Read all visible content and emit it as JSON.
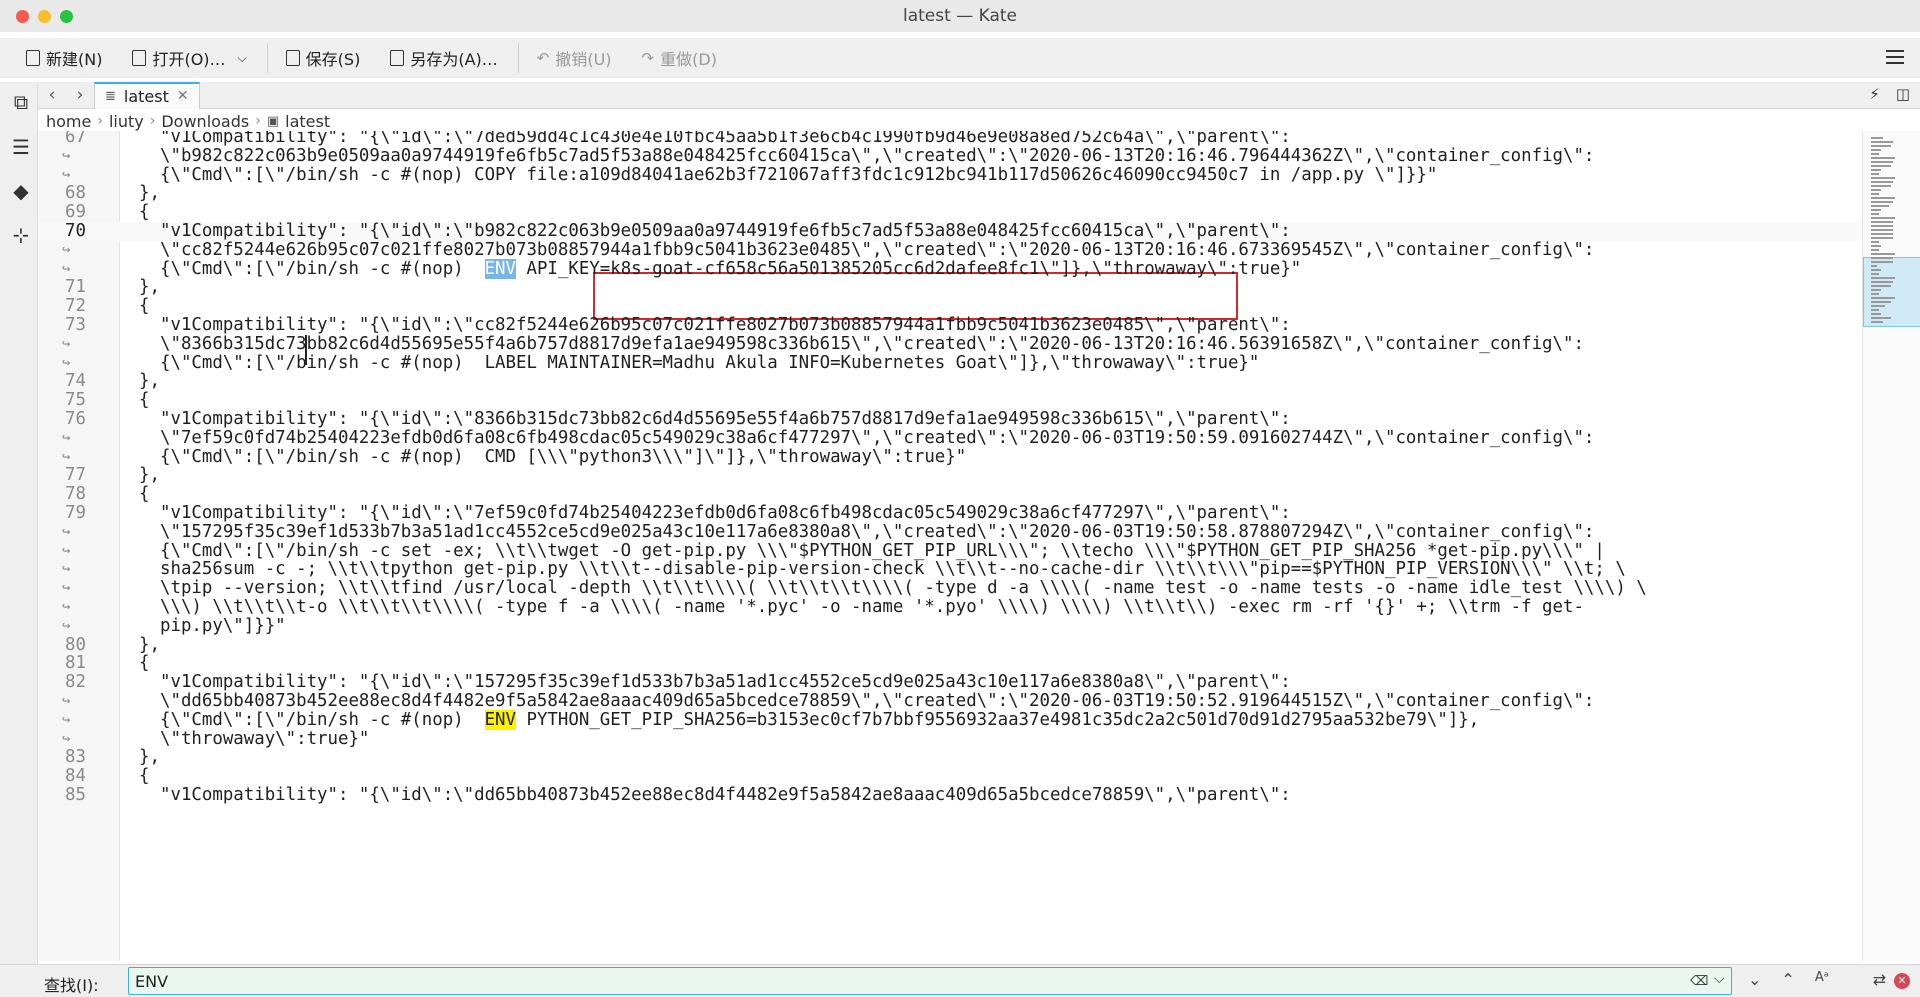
{
  "window": {
    "title": "latest — Kate"
  },
  "toolbar": {
    "new_label": "新建(N)",
    "open_label": "打开(O)…",
    "save_label": "保存(S)",
    "save_as_label": "另存为(A)…",
    "undo_label": "撤销(U)",
    "redo_label": "重做(D)"
  },
  "tab": {
    "label": "latest"
  },
  "breadcrumb": [
    "home",
    "liuty",
    "Downloads",
    "latest"
  ],
  "find": {
    "label": "查找(I):",
    "value": "ENV",
    "highlight_color": "#fff200",
    "selection_color": "#76b5e6"
  },
  "editor": {
    "lines": [
      {
        "num": "67",
        "parts": [
          {
            "t": "\"v1Compatibility\": \"{\\\"id\\\":\\\"7ded59dd4c1c430e4e10fbc45aa5b1f3e6cb4c1990fb9d46e9e08a8ed752c64a\\\",\\\"parent\\\":"
          }
        ]
      },
      {
        "num": "",
        "wrap": true,
        "parts": [
          {
            "t": "\\\"b982c822c063b9e0509aa0a9744919fe6fb5c7ad5f53a88e048425fcc60415ca\\\",\\\"created\\\":\\\"2020-06-13T20:16:46.796444362Z\\\",\\\"container_config\\\":"
          }
        ]
      },
      {
        "num": "",
        "wrap": true,
        "parts": [
          {
            "t": "{\\\"Cmd\\\":[\\\"/bin/sh -c #(nop) COPY file:a109d84041ae62b3f721067aff3fdc1c912bc941b117d50626c46090cc9450c7 in /app.py \\\"]}}\""
          }
        ]
      },
      {
        "num": "68",
        "indent": -1,
        "parts": [
          {
            "t": "},"
          }
        ]
      },
      {
        "num": "69",
        "indent": -1,
        "parts": [
          {
            "t": "{"
          }
        ]
      },
      {
        "num": "70",
        "current": true,
        "parts": [
          {
            "t": "\"v1Compatibility\": \"{\\\"id\\\":\\\"b982c822c063b9e0509aa0a9744919fe6fb5c7ad5f53a88e048425fcc60415ca\\\",\\\"parent\\\":"
          }
        ]
      },
      {
        "num": "",
        "wrap": true,
        "parts": [
          {
            "t": "\\\"cc82f5244e626b95c07c021ffe8027b073b08857944a1fbb9c5041b3623e0485\\\",\\\"created\\\":\\\"2020-06-13T20:16:46.673369545Z\\\",\\\"container_config\\\":"
          }
        ]
      },
      {
        "num": "",
        "wrap": true,
        "parts": [
          {
            "t": "{\\\"Cmd\\\":[\\\"/bin/sh -c #(nop)  "
          },
          {
            "t": "ENV",
            "cls": "hl-sel"
          },
          {
            "t": " API_KEY=k8s-goat-cf658c56a501385205cc6d2dafee8fc1\\\"]},\\\"throwaway\\\":true}\""
          }
        ]
      },
      {
        "num": "71",
        "indent": -1,
        "parts": [
          {
            "t": "},"
          }
        ]
      },
      {
        "num": "72",
        "indent": -1,
        "parts": [
          {
            "t": "{"
          }
        ]
      },
      {
        "num": "73",
        "parts": [
          {
            "t": "\"v1Compatibility\": \"{\\\"id\\\":\\\"cc82f5244e626b95c07c021ffe8027b073b08857944a1fbb9c5041b3623e0485\\\",\\\"parent\\\":"
          }
        ]
      },
      {
        "num": "",
        "wrap": true,
        "parts": [
          {
            "t": "\\\"8366b315dc73bb82c6d4d55695e55f4a6b757d8817d9efa1ae949598c336b615\\\",\\\"created\\\":\\\"2020-06-13T20:16:46.56391658Z\\\",\\\"container_config\\\":"
          }
        ]
      },
      {
        "num": "",
        "wrap": true,
        "parts": [
          {
            "t": "{\\\"Cmd\\\":[\\\"/bin/sh -c #(nop)  LABEL MAINTAINER=Madhu Akula INFO=Kubernetes Goat\\\"]},\\\"throwaway\\\":true}\""
          }
        ]
      },
      {
        "num": "74",
        "indent": -1,
        "parts": [
          {
            "t": "},"
          }
        ]
      },
      {
        "num": "75",
        "indent": -1,
        "parts": [
          {
            "t": "{"
          }
        ]
      },
      {
        "num": "76",
        "parts": [
          {
            "t": "\"v1Compatibility\": \"{\\\"id\\\":\\\"8366b315dc73bb82c6d4d55695e55f4a6b757d8817d9efa1ae949598c336b615\\\",\\\"parent\\\":"
          }
        ]
      },
      {
        "num": "",
        "wrap": true,
        "parts": [
          {
            "t": "\\\"7ef59c0fd74b25404223efdb0d6fa08c6fb498cdac05c549029c38a6cf477297\\\",\\\"created\\\":\\\"2020-06-03T19:50:59.091602744Z\\\",\\\"container_config\\\":"
          }
        ]
      },
      {
        "num": "",
        "wrap": true,
        "parts": [
          {
            "t": "{\\\"Cmd\\\":[\\\"/bin/sh -c #(nop)  CMD [\\\\\\\"python3\\\\\\\"]\\\"]},\\\"throwaway\\\":true}\""
          }
        ]
      },
      {
        "num": "77",
        "indent": -1,
        "parts": [
          {
            "t": "},"
          }
        ]
      },
      {
        "num": "78",
        "indent": -1,
        "parts": [
          {
            "t": "{"
          }
        ]
      },
      {
        "num": "79",
        "parts": [
          {
            "t": "\"v1Compatibility\": \"{\\\"id\\\":\\\"7ef59c0fd74b25404223efdb0d6fa08c6fb498cdac05c549029c38a6cf477297\\\",\\\"parent\\\":"
          }
        ]
      },
      {
        "num": "",
        "wrap": true,
        "parts": [
          {
            "t": "\\\"157295f35c39ef1d533b7b3a51ad1cc4552ce5cd9e025a43c10e117a6e8380a8\\\",\\\"created\\\":\\\"2020-06-03T19:50:58.878807294Z\\\",\\\"container_config\\\":"
          }
        ]
      },
      {
        "num": "",
        "wrap": true,
        "parts": [
          {
            "t": "{\\\"Cmd\\\":[\\\"/bin/sh -c set -ex; \\\\t\\\\twget -O get-pip.py \\\\\\\"$PYTHON_GET_PIP_URL\\\\\\\"; \\\\techo \\\\\\\"$PYTHON_GET_PIP_SHA256 *get-pip.py\\\\\\\" |"
          }
        ]
      },
      {
        "num": "",
        "wrap": true,
        "parts": [
          {
            "t": "sha256sum -c -; \\\\t\\\\tpython get-pip.py \\\\t\\\\t--disable-pip-version-check \\\\t\\\\t--no-cache-dir \\\\t\\\\t\\\\\\\"pip==$PYTHON_PIP_VERSION\\\\\\\" \\\\t; \\"
          }
        ]
      },
      {
        "num": "",
        "wrap": true,
        "parts": [
          {
            "t": "\\tpip --version; \\\\t\\\\tfind /usr/local -depth \\\\t\\\\t\\\\\\\\( \\\\t\\\\t\\\\t\\\\\\\\( -type d -a \\\\\\\\( -name test -o -name tests -o -name idle_test \\\\\\\\) \\"
          }
        ]
      },
      {
        "num": "",
        "wrap": true,
        "parts": [
          {
            "t": "\\\\\\) \\\\t\\\\t\\\\t-o \\\\t\\\\t\\\\t\\\\\\\\( -type f -a \\\\\\\\( -name '*.pyc' -o -name '*.pyo' \\\\\\\\) \\\\\\\\) \\\\t\\\\t\\\\) -exec rm -rf '{}' +; \\\\trm -f get-"
          }
        ]
      },
      {
        "num": "",
        "wrap": true,
        "parts": [
          {
            "t": "pip.py\\\"]}}\""
          }
        ]
      },
      {
        "num": "80",
        "indent": -1,
        "parts": [
          {
            "t": "},"
          }
        ]
      },
      {
        "num": "81",
        "indent": -1,
        "parts": [
          {
            "t": "{"
          }
        ]
      },
      {
        "num": "82",
        "parts": [
          {
            "t": "\"v1Compatibility\": \"{\\\"id\\\":\\\"157295f35c39ef1d533b7b3a51ad1cc4552ce5cd9e025a43c10e117a6e8380a8\\\",\\\"parent\\\":"
          }
        ]
      },
      {
        "num": "",
        "wrap": true,
        "parts": [
          {
            "t": "\\\"dd65bb40873b452ee88ec8d4f4482e9f5a5842ae8aaac409d65a5bcedce78859\\\",\\\"created\\\":\\\"2020-06-03T19:50:52.919644515Z\\\",\\\"container_config\\\":"
          }
        ]
      },
      {
        "num": "",
        "wrap": true,
        "parts": [
          {
            "t": "{\\\"Cmd\\\":[\\\"/bin/sh -c #(nop)  "
          },
          {
            "t": "ENV",
            "cls": "hl-find"
          },
          {
            "t": " PYTHON_GET_PIP_SHA256=b3153ec0cf7b7bbf9556932aa37e4981c35dc2a2c501d70d91d2795aa532be79\\\"]},"
          }
        ]
      },
      {
        "num": "",
        "wrap": true,
        "parts": [
          {
            "t": "\\\"throwaway\\\":true}\""
          }
        ]
      },
      {
        "num": "83",
        "indent": -1,
        "parts": [
          {
            "t": "},"
          }
        ]
      },
      {
        "num": "84",
        "indent": -1,
        "parts": [
          {
            "t": "{"
          }
        ]
      },
      {
        "num": "85",
        "parts": [
          {
            "t": "\"v1Compatibility\": \"{\\\"id\\\":\\\"dd65bb40873b452ee88ec8d4f4482e9f5a5842ae8aaac409d65a5bcedce78859\\\",\\\"parent\\\":"
          }
        ]
      }
    ]
  }
}
